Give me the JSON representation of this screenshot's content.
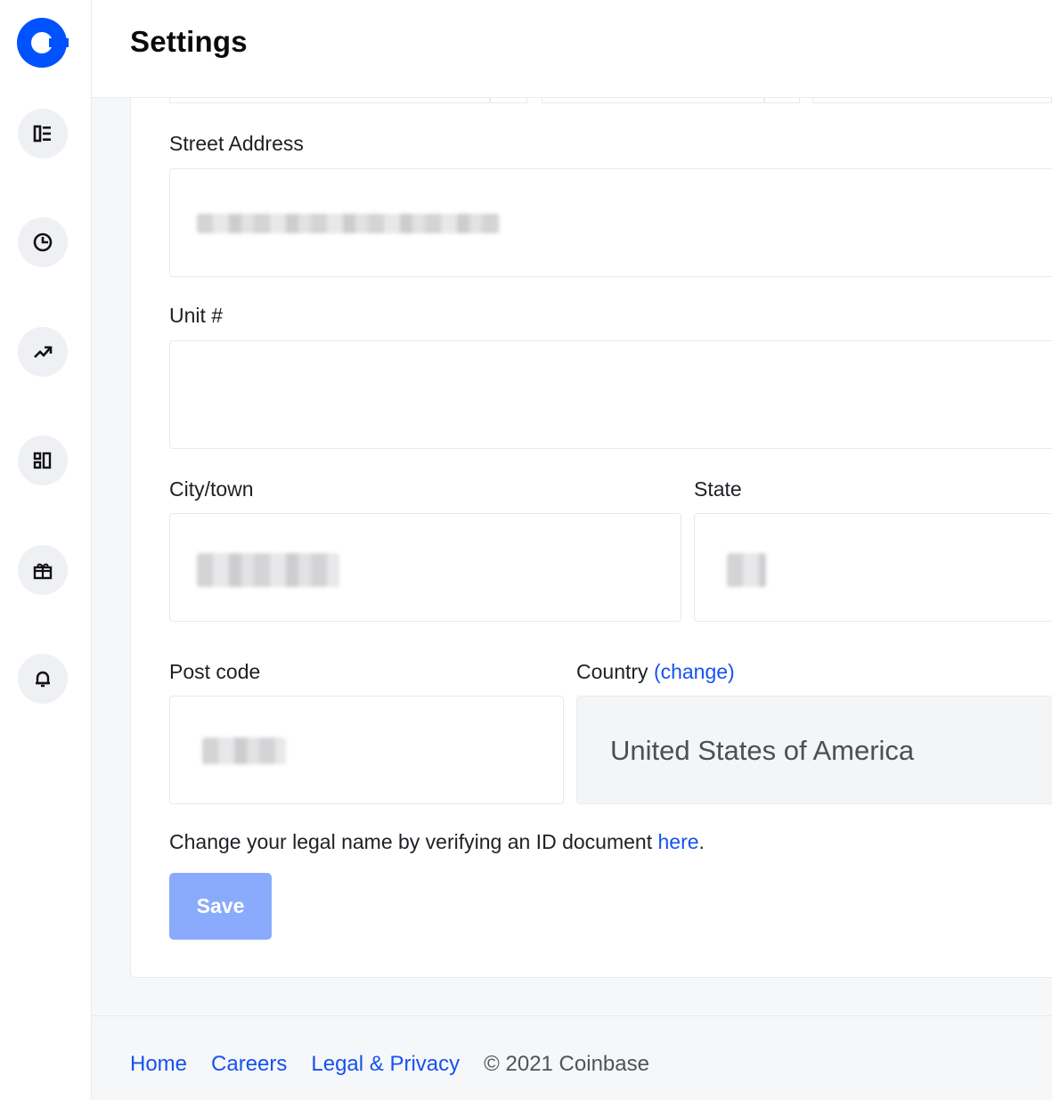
{
  "header": {
    "title": "Settings"
  },
  "sidebar": {
    "items": [
      {
        "icon": "dashboard-icon"
      },
      {
        "icon": "portfolio-pie-icon"
      },
      {
        "icon": "trade-chart-icon"
      },
      {
        "icon": "assets-grid-icon"
      },
      {
        "icon": "gift-icon"
      },
      {
        "icon": "bell-icon"
      }
    ]
  },
  "form": {
    "street_label": "Street Address",
    "unit_label": "Unit #",
    "city_label": "City/town",
    "state_label": "State",
    "postcode_label": "Post code",
    "country_label": "Country",
    "country_change": "(change)",
    "country_value": "United States of America",
    "note_text": "Change your legal name by verifying an ID document ",
    "note_link": "here",
    "note_end": ".",
    "save_label": "Save"
  },
  "footer": {
    "links": [
      "Home",
      "Careers",
      "Legal & Privacy"
    ],
    "copyright": "© 2021 Coinbase"
  },
  "colors": {
    "brand_blue": "#0052ff",
    "link_blue": "#1652f0",
    "save_disabled": "#8aabfb"
  }
}
